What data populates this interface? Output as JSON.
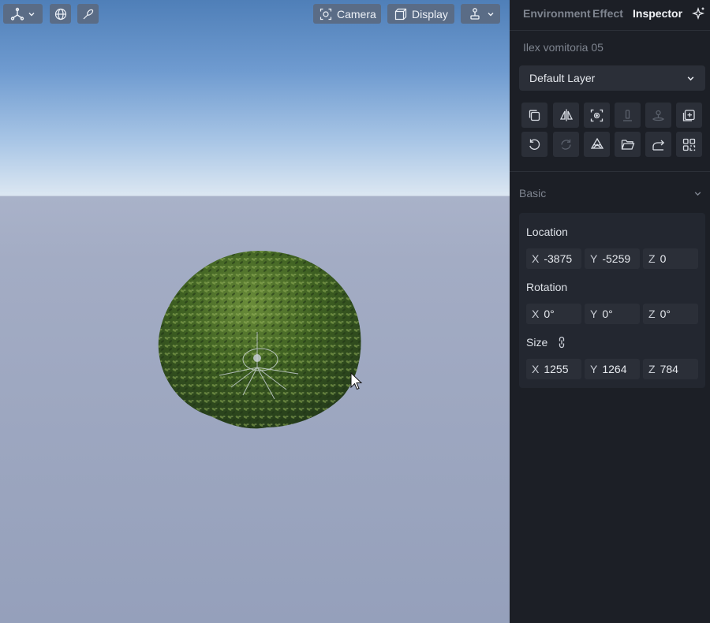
{
  "viewport": {
    "toolbar": {
      "camera_label": "Camera",
      "display_label": "Display"
    },
    "icons": [
      "axes-icon",
      "globe-icon",
      "brush-icon",
      "camera-icon",
      "display-cube-icon",
      "gizmo-icon",
      "chevron-down-icon",
      "cursor-icon"
    ]
  },
  "panel": {
    "tabs": [
      {
        "label": "Environment",
        "active": false
      },
      {
        "label": "Effect",
        "active": false
      },
      {
        "label": "Inspector",
        "active": true
      }
    ],
    "object_name": "Ilex vomitoria 05",
    "layer": "Default Layer",
    "basic": {
      "title": "Basic",
      "location": {
        "label": "Location",
        "x": "-3875",
        "y": "-5259",
        "z": "0"
      },
      "rotation": {
        "label": "Rotation",
        "x": "0°",
        "y": "0°",
        "z": "0°"
      },
      "size": {
        "label": "Size",
        "x": "1255",
        "y": "1264",
        "z": "784"
      },
      "axis_labels": {
        "x": "X",
        "y": "Y",
        "z": "Z"
      }
    },
    "tool_icons": [
      "duplicate-icon",
      "mirror-icon",
      "focus-icon",
      "align-floor-icon",
      "drop-to-ground-icon",
      "add-layer-icon",
      "undo-icon",
      "redo-icon",
      "material-icon",
      "folder-icon",
      "share-icon",
      "qr-grid-icon"
    ],
    "colors": {
      "panel_bg": "#1c1f26",
      "field_bg": "#2b2f38",
      "toolbar_btn": "#5a6c86",
      "active_tab": "#f2f4f8",
      "muted_text": "#7e848f"
    }
  }
}
